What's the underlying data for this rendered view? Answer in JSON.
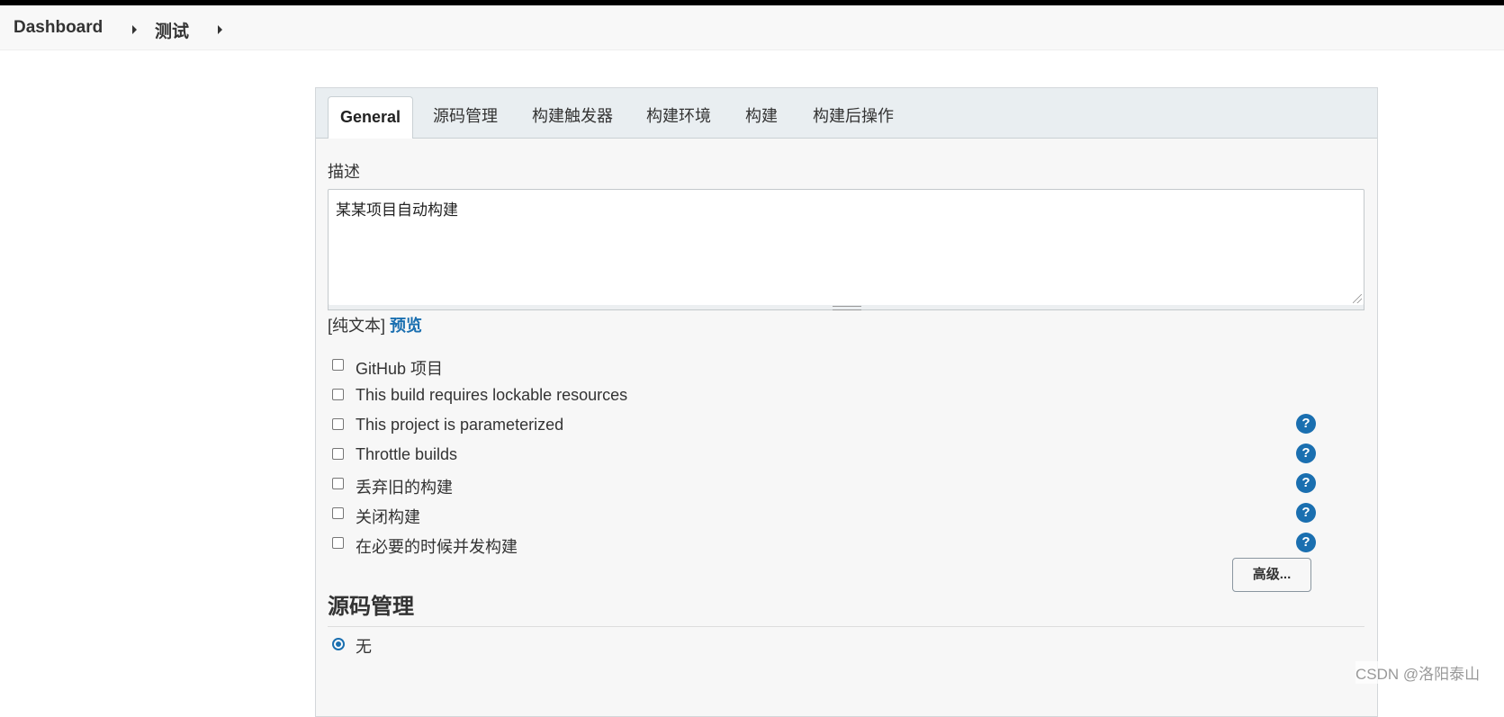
{
  "breadcrumb": {
    "items": [
      "Dashboard",
      "测试"
    ]
  },
  "tabs": [
    "General",
    "源码管理",
    "构建触发器",
    "构建环境",
    "构建",
    "构建后操作"
  ],
  "description": {
    "label": "描述",
    "value": "某某项目自动构建",
    "format_plain": "[纯文本]",
    "format_preview": "预览"
  },
  "options": [
    {
      "label": "GitHub 项目",
      "checked": false,
      "help": false
    },
    {
      "label": "This build requires lockable resources",
      "checked": false,
      "help": false
    },
    {
      "label": "This project is parameterized",
      "checked": false,
      "help": true
    },
    {
      "label": "Throttle builds",
      "checked": false,
      "help": true
    },
    {
      "label": "丢弃旧的构建",
      "checked": false,
      "help": true
    },
    {
      "label": "关闭构建",
      "checked": false,
      "help": true
    },
    {
      "label": "在必要的时候并发构建",
      "checked": false,
      "help": true
    }
  ],
  "help_glyph": "?",
  "advanced_button": "高级...",
  "scm": {
    "title": "源码管理",
    "selected_option": "无"
  },
  "watermark": "CSDN @洛阳泰山",
  "colors": {
    "accent": "#1a6fb0",
    "panel_bg": "#f7f7f7",
    "tab_bar_bg": "#e9eef1"
  }
}
